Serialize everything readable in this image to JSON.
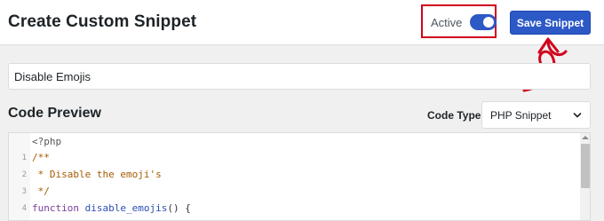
{
  "header": {
    "title": "Create Custom Snippet",
    "active_label": "Active",
    "active_state": true,
    "save_label": "Save Snippet"
  },
  "snippet": {
    "title_value": "Disable Emojis"
  },
  "code_preview": {
    "section_title": "Code Preview",
    "code_type_label": "Code Type",
    "code_type_value": "PHP Snippet",
    "lines": [
      {
        "num": "",
        "text": "<?php"
      },
      {
        "num": "1",
        "text": "/**"
      },
      {
        "num": "2",
        "text": " * Disable the emoji's"
      },
      {
        "num": "3",
        "text": " */"
      },
      {
        "num": "4",
        "kw": "function",
        "fn": "disable_emojis",
        "rest": "() {"
      }
    ]
  },
  "colors": {
    "accent": "#2d59c6",
    "highlight": "#d0021b"
  },
  "icons": [
    "chevron-down-icon",
    "curved-arrow-icon"
  ]
}
